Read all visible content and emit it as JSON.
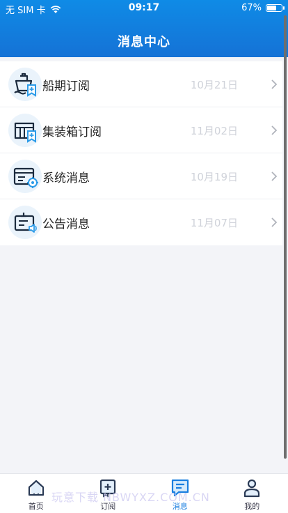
{
  "status_bar": {
    "carrier": "无 SIM 卡",
    "time": "09:17",
    "battery_percent": "67%",
    "battery_level": 0.67
  },
  "header": {
    "title": "消息中心"
  },
  "messages": [
    {
      "label": "船期订阅",
      "date": "10月21日",
      "icon": "ship-bookmark-icon"
    },
    {
      "label": "集装箱订阅",
      "date": "11月02日",
      "icon": "container-bookmark-icon"
    },
    {
      "label": "系统消息",
      "date": "10月19日",
      "icon": "system-settings-icon"
    },
    {
      "label": "公告消息",
      "date": "11月07日",
      "icon": "announcement-icon"
    }
  ],
  "tabbar": {
    "tabs": [
      {
        "label": "首页",
        "icon": "home-icon"
      },
      {
        "label": "订阅",
        "icon": "subscribe-icon"
      },
      {
        "label": "消息",
        "icon": "message-icon",
        "active": true
      },
      {
        "label": "我的",
        "icon": "profile-icon"
      }
    ]
  },
  "watermark": "玩意下载 NBWYXZ.COM.CN",
  "colors": {
    "header": "#1572d6",
    "accent": "#1a7fe0",
    "date": "#d0d3da"
  }
}
